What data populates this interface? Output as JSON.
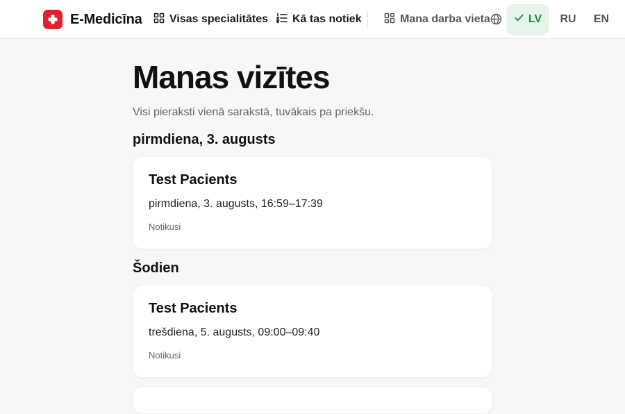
{
  "header": {
    "brand": "E-Medicīna",
    "nav": {
      "specialties": "Visas specialitātes",
      "how_it_works": "Kā tas notiek",
      "workplace": "Mana darba vieta"
    },
    "languages": [
      "LV",
      "RU",
      "EN"
    ],
    "active_language": "LV"
  },
  "main": {
    "title": "Manas vizītes",
    "subtitle": "Visi pieraksti vienā sarakstā, tuvākais pa priekšu.",
    "groups": [
      {
        "heading": "pirmdiena, 3. augusts",
        "appointments": [
          {
            "patient": "Test Pacients",
            "time": "pirmdiena, 3. augusts, 16:59–17:39",
            "status": "Notikusi"
          }
        ]
      },
      {
        "heading": "Šodien",
        "appointments": [
          {
            "patient": "Test Pacients",
            "time": "trešdiena, 5. augusts, 09:00–09:40",
            "status": "Notikusi"
          }
        ]
      }
    ]
  },
  "colors": {
    "brand_red": "#e5202e",
    "active_lang_bg": "#e6f4ea",
    "active_lang_text": "#1e8a3f"
  },
  "icons": {
    "brand": "medical-cross-icon",
    "specialties": "grid-icon",
    "how_it_works": "numbered-list-icon",
    "workplace": "dashboard-icon",
    "language": "globe-icon",
    "active_language": "check-icon"
  }
}
